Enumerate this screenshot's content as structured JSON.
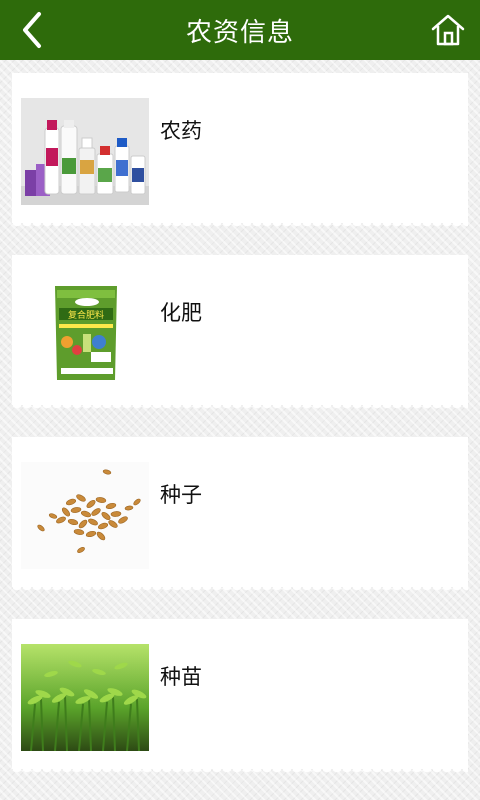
{
  "header": {
    "title": "农资信息",
    "back_icon": "chevron-left-icon",
    "home_icon": "home-icon",
    "bar_color": "#2e6b0b"
  },
  "items": [
    {
      "label": "农药",
      "image": "pesticide-bottles-image"
    },
    {
      "label": "化肥",
      "image": "fertilizer-bag-image",
      "bag_text": "复合肥料"
    },
    {
      "label": "种子",
      "image": "seeds-image"
    },
    {
      "label": "种苗",
      "image": "seedlings-image"
    }
  ]
}
